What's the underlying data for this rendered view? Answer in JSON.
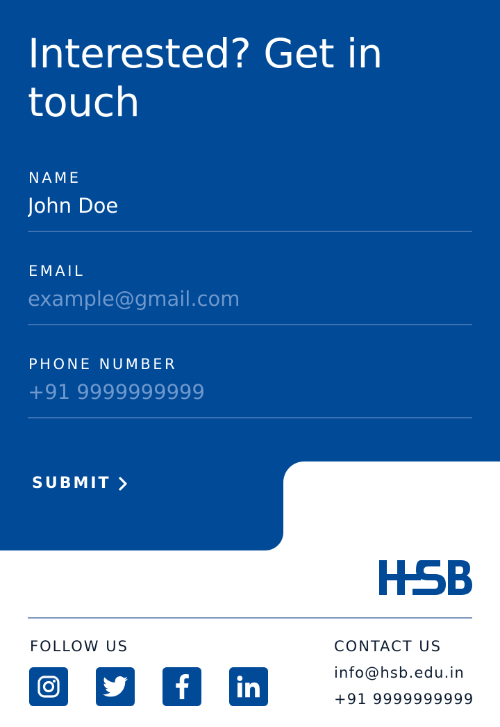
{
  "heading": "Interested? Get in touch",
  "form": {
    "name": {
      "label": "NAME",
      "value": "John Doe",
      "placeholder": ""
    },
    "email": {
      "label": "EMAIL",
      "value": "",
      "placeholder": "example@gmail.com"
    },
    "phone": {
      "label": "PHONE NUMBER",
      "value": "",
      "placeholder": "+91 9999999999"
    },
    "submit_label": "SUBMIT"
  },
  "logo": {
    "text": "HSB"
  },
  "follow": {
    "title": "FOLLOW US",
    "icons": [
      "instagram-icon",
      "twitter-icon",
      "facebook-icon",
      "linkedin-icon"
    ]
  },
  "contact": {
    "title": "CONTACT US",
    "email": "info@hsb.edu.in",
    "phone": "+91 9999999999"
  },
  "colors": {
    "brand_blue": "#004a98",
    "placeholder": "#6f98cc",
    "text_dark": "#0b1a2e",
    "background": "#ffffff"
  }
}
